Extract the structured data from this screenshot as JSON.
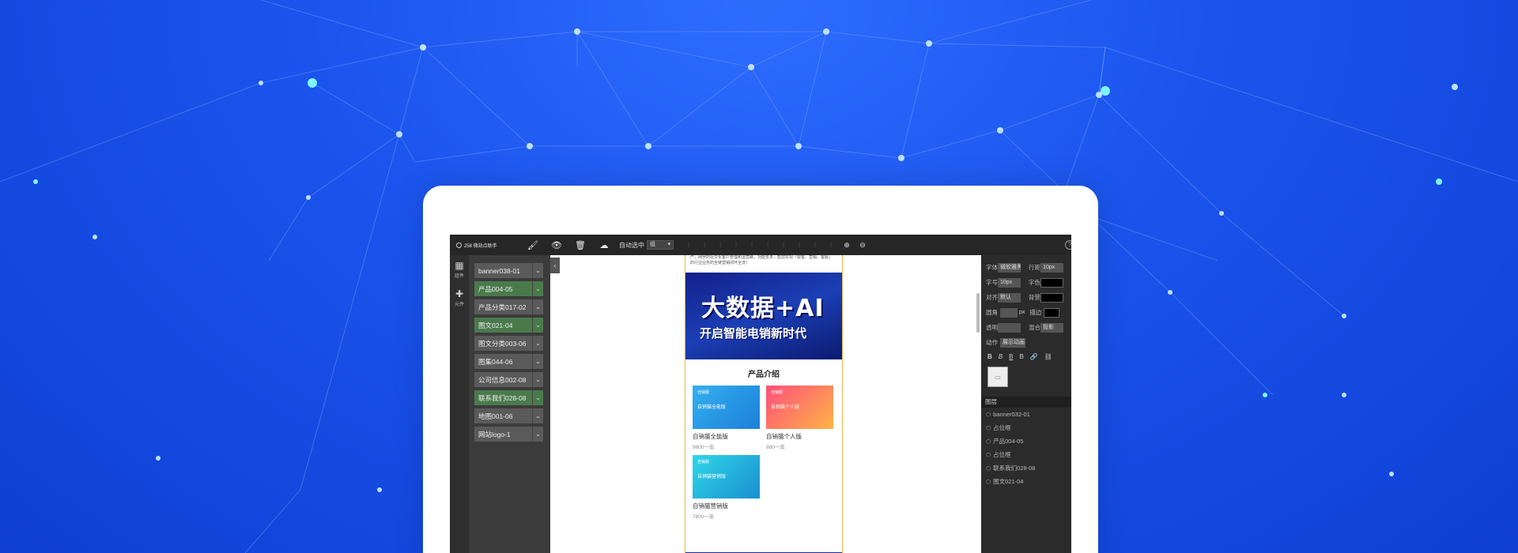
{
  "theme": {
    "background": "#1b55ee",
    "toolbar": "#262626",
    "panel": "#3b3b3b",
    "active_item": "#4a7a4c",
    "accent_border": "#f0b34b"
  },
  "app": {
    "logo_text": "258 微站点助手"
  },
  "toolbar": {
    "brush_icon": "brush-icon",
    "eye_icon": "eye-icon",
    "trash_icon": "trash-icon",
    "cloud_icon": "cloud-save-icon",
    "auto_select_label": "自动选中",
    "auto_select_value": "组"
  },
  "rail": {
    "items": [
      {
        "label": "组件",
        "icon": "grid-icon"
      },
      {
        "label": "元件",
        "icon": "puzzle-icon"
      }
    ]
  },
  "components": [
    {
      "label": "banner038-01",
      "active": false
    },
    {
      "label": "产品004-05",
      "active": true
    },
    {
      "label": "产品分类017-02",
      "active": false
    },
    {
      "label": "图文021-04",
      "active": true
    },
    {
      "label": "图文分类003-06",
      "active": false
    },
    {
      "label": "图集044-06",
      "active": false
    },
    {
      "label": "公司信息002-08",
      "active": false
    },
    {
      "label": "联系我们028-08",
      "active": true
    },
    {
      "label": "地图001-06",
      "active": false
    },
    {
      "label": "网站logo-1",
      "active": false
    }
  ],
  "canvas": {
    "intro_line1": "产，网罗的社交化客户管理和运营路，功能多多，帮您实现「获客、营销、客服」",
    "intro_line2": "的行业业务的全链营销闭环全流！",
    "hero_line1": "大数据+AI",
    "hero_line2": "开启智能电销新时代",
    "section_title": "产品介绍",
    "products": [
      {
        "logo": "自销服",
        "tag": "自销猫全能版",
        "name": "自销猫全能版",
        "price": "9800一年",
        "color": "#2aa3e6"
      },
      {
        "logo": "自销服",
        "tag": "自销猫个人版",
        "name": "自销猫个人版",
        "price": "980一年",
        "color": "#f7694f"
      },
      {
        "logo": "自销服",
        "tag": "自销猫营销版",
        "name": "自销猫营销版",
        "price": "7800一年",
        "color": "#1bb7d6"
      }
    ]
  },
  "props": {
    "font_label": "字体",
    "font_value": "微软雅黑",
    "line_label": "行距",
    "line_value": "10px",
    "size_label": "字号",
    "size_value": "10px",
    "color_label": "字色",
    "align_label": "对齐",
    "align_value": "默认",
    "bg_label": "背景",
    "radius_label": "圆角",
    "radius_unit": "px",
    "stroke_label": "描边",
    "opacity_label": "透明",
    "blend_label": "混合",
    "blend_value": "投影",
    "action_label": "动作",
    "action_value": "展示动画",
    "layers_title": "图层",
    "layers": [
      "banner032-01",
      "占位框",
      "产品004-05",
      "占位框",
      "联系我们028-08",
      "图文021-04"
    ]
  }
}
